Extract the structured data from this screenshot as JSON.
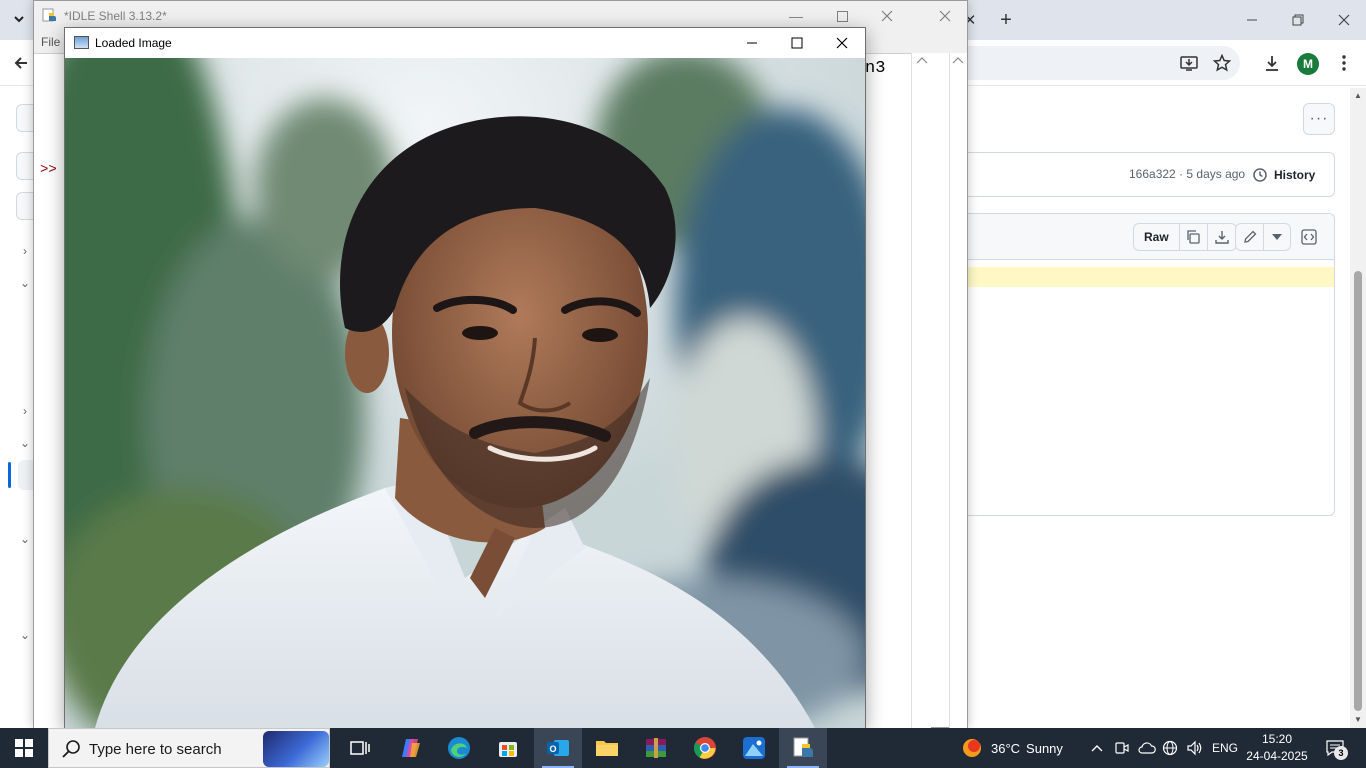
{
  "browser": {
    "commit": "166a322 · 5 days ago",
    "history_label": "History",
    "raw_label": "Raw",
    "more_label": "···",
    "avatar_letter": "M"
  },
  "idle": {
    "title": "*IDLE Shell 3.13.2*",
    "menu_file": "File",
    "prompt": ">>",
    "banner_fragment": "n3"
  },
  "image_window": {
    "title": "Loaded Image"
  },
  "taskbar": {
    "search_placeholder": "Type here to search",
    "weather_temp": "36°C",
    "weather_text": "Sunny",
    "language": "ENG",
    "time": "15:20",
    "date": "24-04-2025",
    "notification_count": "3"
  },
  "colors": {
    "accent": "#0969da",
    "highlight": "#fff8c5",
    "taskbar": "#202a36"
  }
}
